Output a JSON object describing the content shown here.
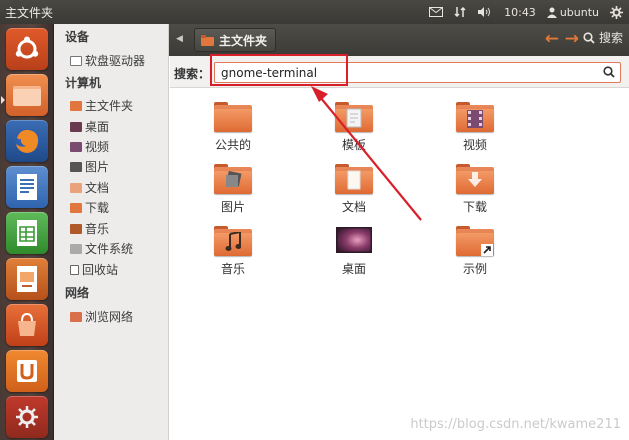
{
  "window": {
    "title": "主文件夹"
  },
  "panel": {
    "time": "10:43",
    "user": "ubuntu"
  },
  "header": {
    "breadcrumb": "主文件夹",
    "search_label": "搜索"
  },
  "sidebar": {
    "devices_title": "设备",
    "devices": [
      {
        "label": "软盘驱动器"
      }
    ],
    "computer_title": "计算机",
    "computer": [
      {
        "label": "主文件夹"
      },
      {
        "label": "桌面"
      },
      {
        "label": "视频"
      },
      {
        "label": "图片"
      },
      {
        "label": "文档"
      },
      {
        "label": "下载"
      },
      {
        "label": "音乐"
      },
      {
        "label": "文件系统"
      },
      {
        "label": "回收站"
      }
    ],
    "network_title": "网络",
    "network": [
      {
        "label": "浏览网络"
      }
    ]
  },
  "search": {
    "label": "搜索：",
    "value": "gnome-terminal"
  },
  "files": [
    {
      "label": "公共的"
    },
    {
      "label": "模板"
    },
    {
      "label": "视频"
    },
    {
      "label": "图片"
    },
    {
      "label": "文档"
    },
    {
      "label": "下载"
    },
    {
      "label": "音乐"
    },
    {
      "label": "桌面"
    },
    {
      "label": "示例"
    }
  ],
  "watermark": "https://blog.csdn.net/kwame211",
  "colors": {
    "accent": "#dd4814",
    "folder": "#e2763f",
    "annotation": "#d8202a"
  }
}
